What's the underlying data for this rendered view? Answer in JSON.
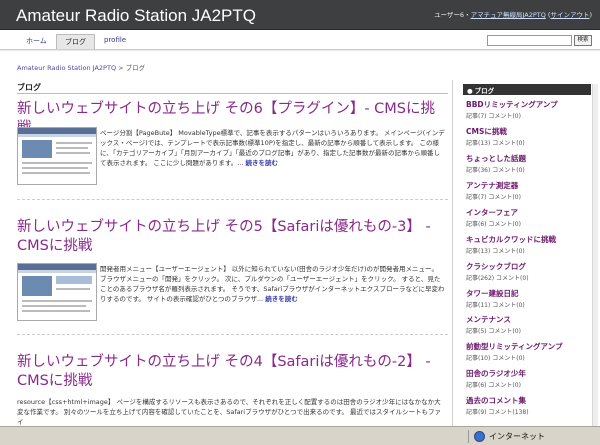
{
  "header": {
    "site_title": "Amateur Radio Station JA2PTQ",
    "user_prefix": "ユーザー6・",
    "user_name": "アマチュア無線局JA2PTQ",
    "signout_open": " (",
    "signout_label": "サインアウト",
    "signout_close": ")"
  },
  "tabs": [
    {
      "label": "ホーム"
    },
    {
      "label": "ブログ"
    },
    {
      "label": "profile"
    }
  ],
  "search": {
    "button_label": "検索"
  },
  "breadcrumb": {
    "home": "Amateur Radio Station JA2PTQ",
    "sep": " > ",
    "current": "ブログ"
  },
  "main": {
    "section_title": "ブログ",
    "posts": [
      {
        "title": "新しいウェブサイトの立ち上げ その6【プラグイン】- CMSに挑戦",
        "excerpt": "ページ分割【PageBute】 MovableType標準で、記事を表示するパターンはいろいろあります。 メインページ(インデックス・ページ)では、テンプレートで表示記事数(標準10P)を指定し、最新の記事から順番して表示します。 この様に、「カテゴリアーカイブ」「月別アーカイブ」「最近のブログ記事」があり、指定した記事数が最新の記事から順番して表示されます。 ここに少し問題があります。...",
        "more": "続きを読む"
      },
      {
        "title": "新しいウェブサイトの立ち上げ その5【Safariは優れもの-3】 - CMSに挑戦",
        "excerpt": "開発者用メニュー【ユーザーエージェント】 以外に知られていない(田舎のラジオ少年だけ)のが開発者用メニュー。 ブラウザメニューの「開発」をクリック。 次に、ブルダウンの「ユーザーエージェント」をクリック。 すると、見たことのあるブラウザ名が羅列表示されます。 そうです、Safariブラウザがインターネットエクスプローラなどに早変わりするのです。 サイトの表示確認がひとつのブラウザ...",
        "more": "続きを読む"
      },
      {
        "title": "新しいウェブサイトの立ち上げ その4【Safariは優れもの-2】 - CMSに挑戦",
        "excerpt": "resource【css+html+image】 ページを構成するリソースも表示さあるので、それぞれを正しく配置するのは田舎のラジオ少年にはなかなか大変な作業です。 別々のツールを立ち上げて内容を確認していたことを、Safariブラウザがひとつで出来るのです。 最近ではスタイルシートもファイ"
      }
    ]
  },
  "sidebar": {
    "title": "ブログ",
    "items": [
      {
        "name": "BBDリミッティングアンプ",
        "meta": "記事(7) コメント(0)"
      },
      {
        "name": "CMSに挑戦",
        "meta": "記事(13) コメント(0)"
      },
      {
        "name": "ちょっとした話題",
        "meta": "記事(36) コメント(0)"
      },
      {
        "name": "アンテナ測定器",
        "meta": "記事(7) コメント(0)"
      },
      {
        "name": "インターフェア",
        "meta": "記事(6) コメント(0)"
      },
      {
        "name": "キュビカルクワッドに挑戦",
        "meta": "記事(13) コメント(0)"
      },
      {
        "name": "クラシックブログ",
        "meta": "記事(262) コメント(0)"
      },
      {
        "name": "タワー建設日記",
        "meta": "記事(11) コメント(0)"
      },
      {
        "name": "メンテナンス",
        "meta": "記事(5) コメント(0)"
      },
      {
        "name": "前動型リミッティングアンプ",
        "meta": "記事(10) コメント(0)"
      },
      {
        "name": "田舎のラジオ少年",
        "meta": "記事(6) コメント(0)"
      },
      {
        "name": "過去のコメント集",
        "meta": "記事(9) コメント(138)"
      }
    ]
  },
  "status": {
    "zone_label": "インターネット"
  },
  "colors": {
    "header_bg": "#3e3f40",
    "post_title": "#8a2a8a",
    "sidebar_link": "#6b1a6b"
  }
}
